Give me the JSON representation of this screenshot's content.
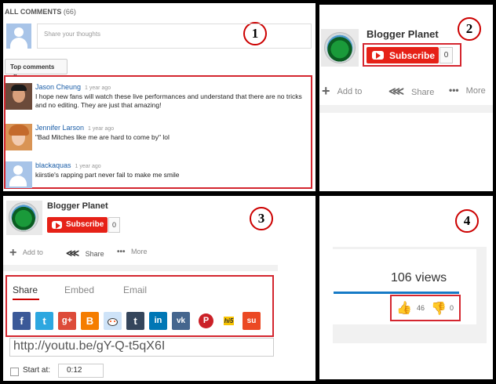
{
  "panel1": {
    "badge": "1",
    "header_title": "ALL COMMENTS",
    "header_count": "(66)",
    "share_placeholder": "Share your thoughts",
    "sort_label": "Top comments",
    "comments": [
      {
        "author": "Jason Cheung",
        "time": "1 year ago",
        "text": "I hope new fans will watch these live performances and understand that there are no tricks and no editing. They are just that amazing!"
      },
      {
        "author": "Jennifer Larson",
        "time": "1 year ago",
        "text": "\"Bad Mitches like me are hard to come by\" lol"
      },
      {
        "author": "blackaquas",
        "time": "1 year ago",
        "text": "kiirstie's rapping part never fail to make me smile"
      }
    ]
  },
  "panel2": {
    "badge": "2",
    "channel_name": "Blogger Planet",
    "subscribe_label": "Subscribe",
    "subscriber_count": "0",
    "actions": {
      "add_to": "Add to",
      "share": "Share",
      "more": "More"
    }
  },
  "panel3": {
    "badge": "3",
    "channel_name": "Blogger Planet",
    "subscribe_label": "Subscribe",
    "subscriber_count": "0",
    "actions": {
      "add_to": "Add to",
      "share": "Share",
      "more": "More"
    },
    "tabs": [
      "Share",
      "Embed",
      "Email"
    ],
    "social_icons": [
      "facebook-icon",
      "twitter-icon",
      "google-plus-icon",
      "blogger-icon",
      "reddit-icon",
      "tumblr-icon",
      "linkedin-icon",
      "vk-icon",
      "pinterest-icon",
      "hi5-icon",
      "stumbleupon-icon"
    ],
    "social_glyphs": [
      "f",
      "t",
      "g+",
      "B",
      "",
      "t",
      "in",
      "vk",
      "P",
      "hi5",
      "su"
    ],
    "share_url": "http://youtu.be/gY-Q-t5qX6I",
    "start_at_label": "Start at:",
    "start_at_value": "0:12"
  },
  "panel4": {
    "badge": "4",
    "views_text": "106 views",
    "likes": "46",
    "dislikes": "0"
  },
  "colors": {
    "subscribe_red": "#e62117",
    "highlight_red": "#d4262f",
    "link_blue": "#1b5ea8",
    "views_bar_blue": "#167ac6"
  }
}
